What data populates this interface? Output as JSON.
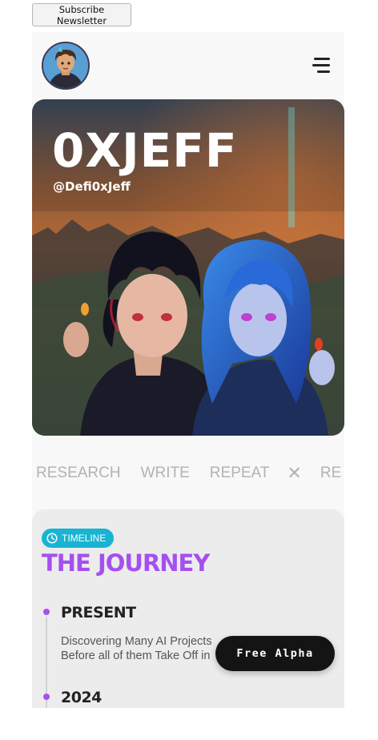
{
  "newsletter": {
    "label": "Subscribe Newsletter"
  },
  "header": {
    "avatar_alt": "profile avatar",
    "menu_icon": "hamburger-menu-icon"
  },
  "hero": {
    "title": "0XJEFF",
    "handle": "@Defi0xJeff"
  },
  "marquee": {
    "words": [
      "RESEARCH",
      "WRITE",
      "REPEAT",
      "RE"
    ],
    "separator": "✕"
  },
  "timeline": {
    "badge_label": "TIMELINE",
    "badge_icon": "clock-icon",
    "title": "THE JOURNEY",
    "entries": [
      {
        "year": "PRESENT",
        "description": "Discovering Many AI Projects Before all of them Take Off in"
      },
      {
        "year": "2024"
      }
    ]
  },
  "cta": {
    "label": "Free Alpha"
  },
  "colors": {
    "accent_purple": "#a64ff0",
    "badge_cyan": "#19b4d2",
    "cta_bg": "#141414"
  }
}
